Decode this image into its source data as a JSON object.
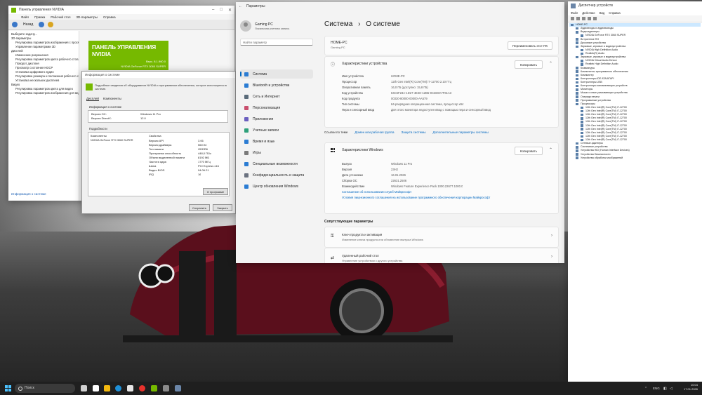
{
  "cp": {
    "title": "Панель управления NVIDIA",
    "menu": [
      "Файл",
      "Правка",
      "Рабочий стол",
      "3D-параметры",
      "Справка"
    ],
    "back": "Назад",
    "tree_header": "Выберите задачу...",
    "tree": [
      {
        "label": "3D-параметры",
        "type": "head"
      },
      {
        "label": "Регулировка параметров изображения с просмотром",
        "type": "link"
      },
      {
        "label": "Управление параметрами 3D",
        "type": "link"
      },
      {
        "label": "Дисплей",
        "type": "head"
      },
      {
        "label": "Изменение разрешения",
        "type": "link"
      },
      {
        "label": "Регулировка параметров цвета рабочего стола",
        "type": "link"
      },
      {
        "label": "Поворот дисплея",
        "type": "link"
      },
      {
        "label": "Просмотр состояния HDCP",
        "type": "link"
      },
      {
        "label": "Установка цифрового аудио",
        "type": "link"
      },
      {
        "label": "Регулировка размера и положения рабочего стола",
        "type": "link"
      },
      {
        "label": "Установка нескольких дисплеев",
        "type": "link"
      },
      {
        "label": "Видео",
        "type": "head"
      },
      {
        "label": "Регулировка параметров цвета для видео",
        "type": "link"
      },
      {
        "label": "Регулировка параметров изображения для видео",
        "type": "link"
      }
    ],
    "banner_title": "ПАНЕЛЬ УПРАВЛЕНИЯ NVIDIA",
    "banner_version": "Верс. 8.1.960.0",
    "banner_gpu": "NVIDIA GeForce RTX 3060 SUPER",
    "info_link": "Информация о системе"
  },
  "si": {
    "title": "Информация о системе",
    "desc": "Подробные сведения об оборудовании NVIDIA и программном обеспечении, которое используется в системе.",
    "tabs": [
      "Дисплей",
      "Компоненты"
    ],
    "sys_section": "Информация о системе",
    "sys_rows": [
      {
        "k": "Версия ОС:",
        "v": "Windows 11 Pro"
      },
      {
        "k": "Версия DirectX:",
        "v": "12.0"
      }
    ],
    "detail_section": "Подробности",
    "col_comp": "Компоненты",
    "col_props": "Свойства",
    "gpu": "NVIDIA GeForce RTX 3060 SUPER",
    "props": [
      {
        "k": "Версия API",
        "v": "3.06"
      },
      {
        "k": "Версия драйвера",
        "v": "560.94"
      },
      {
        "k": "Тип памяти",
        "v": "GDDR6"
      },
      {
        "k": "Пропускная способность",
        "v": "448,0 ГБ/с"
      },
      {
        "k": "Объем выделенной памяти",
        "v": "8192 МБ"
      },
      {
        "k": "Частота ядра",
        "v": "1770 МГц"
      },
      {
        "k": "Шина",
        "v": "PCI Express x16"
      },
      {
        "k": "Видео BIOS",
        "v": "94.06.21"
      },
      {
        "k": "IRQ",
        "v": "16"
      }
    ],
    "about_btn": "О программе",
    "save_btn": "Сохранить",
    "close_btn": "Закрыть"
  },
  "st": {
    "title": "Параметры",
    "user_name": "Gaming PC",
    "user_sub": "Локальная учетная запись",
    "search_placeholder": "Найти параметр",
    "nav": [
      {
        "label": "Система",
        "color": "#2b7cd3",
        "sel": true
      },
      {
        "label": "Bluetooth и устройства",
        "color": "#2b7cd3",
        "sel": false
      },
      {
        "label": "Сеть и Интернет",
        "color": "#5a6b7a",
        "sel": false
      },
      {
        "label": "Персонализация",
        "color": "#c94f6d",
        "sel": false
      },
      {
        "label": "Приложения",
        "color": "#6b5fbf",
        "sel": false
      },
      {
        "label": "Учетные записи",
        "color": "#2ea07a",
        "sel": false
      },
      {
        "label": "Время и язык",
        "color": "#2b7cd3",
        "sel": false
      },
      {
        "label": "Игры",
        "color": "#7a7a7a",
        "sel": false
      },
      {
        "label": "Специальные возможности",
        "color": "#2b7cd3",
        "sel": false
      },
      {
        "label": "Конфиденциальность и защита",
        "color": "#6b7280",
        "sel": false
      },
      {
        "label": "Центр обновления Windows",
        "color": "#2b7cd3",
        "sel": false
      }
    ],
    "crumb_parent": "Система",
    "crumb_sep": "›",
    "crumb_current": "О системе",
    "pc_name": "HOME-PC",
    "pc_model": "Gaming PC",
    "rename_btn": "Переименовать этот ПК",
    "device_title": "Характеристики устройства",
    "copy_btn": "Копировать",
    "device_specs": [
      {
        "k": "Имя устройства",
        "v": "HOME-PC"
      },
      {
        "k": "Процессор",
        "v": "12th Gen Intel(R) Core(TM) i7-12700   2.10 ГГц"
      },
      {
        "k": "Оперативная память",
        "v": "16,0 ГБ (доступно: 15,8 ГБ)"
      },
      {
        "k": "Код устройства",
        "v": "84C6F23A-1D27-4E48-A2B5-9C3D8A7F61A3"
      },
      {
        "k": "Код продукта",
        "v": "00330-80000-00000-AA579"
      },
      {
        "k": "Тип системы",
        "v": "64-разрядная операционная система, процессор x64"
      },
      {
        "k": "Перо и сенсорный ввод",
        "v": "Для этого монитора недоступен ввод с помощью пера и сенсорный ввод"
      }
    ],
    "links": [
      "Ссылки по теме",
      "Домен или рабочая группа",
      "Защита системы",
      "Дополнительные параметры системы"
    ],
    "win_title": "Характеристики Windows",
    "win_specs": [
      {
        "k": "Выпуск",
        "v": "Windows 11 Pro"
      },
      {
        "k": "Версия",
        "v": "23H2"
      },
      {
        "k": "Дата установки",
        "v": "16.01.2026"
      },
      {
        "k": "Сборка ОС",
        "v": "22631.2506"
      },
      {
        "k": "Взаимодействие",
        "v": "Windows Feature Experience Pack 1000.22677.1000.0"
      }
    ],
    "win_link1": "Соглашение об использовании служб Майкрософт",
    "win_link2": "Условия лицензионного соглашения на использование программного обеспечения корпорации Майкрософт",
    "related_section": "Сопутствующие параметры",
    "related": [
      {
        "title": "Ключ продукта и активация",
        "sub": "Изменение ключа продукта или обновление выпуска Windows"
      },
      {
        "title": "Удаленный рабочий стол",
        "sub": "Управление устройством с другого устройства"
      }
    ]
  },
  "dm": {
    "title": "Диспетчер устройств",
    "menu": [
      "Файл",
      "Действие",
      "Вид",
      "Справка"
    ],
    "tree": [
      {
        "label": "HOME-PC",
        "indent": 0,
        "sel": true
      },
      {
        "label": "Аудиовходы и аудиовыходы",
        "indent": 1
      },
      {
        "label": "Видеоадаптеры",
        "indent": 1
      },
      {
        "label": "NVIDIA GeForce RTX 3060 SUPER",
        "indent": 2
      },
      {
        "label": "Встроенное ПО",
        "indent": 1
      },
      {
        "label": "Дисковые устройства",
        "indent": 1
      },
      {
        "label": "Звуковые, игровые и видеоустройства",
        "indent": 1
      },
      {
        "label": "NVIDIA High Definition Audio",
        "indent": 2
      },
      {
        "label": "Realtek(R) Audio",
        "indent": 2
      },
      {
        "label": "Звуковые, игровые и видеоустройства",
        "indent": 1
      },
      {
        "label": "NVIDIA Virtual Audio Device",
        "indent": 2
      },
      {
        "label": "Realtek High Definition Audio",
        "indent": 2
      },
      {
        "label": "Клавиатуры",
        "indent": 1
      },
      {
        "label": "Компоненты программного обеспечения",
        "indent": 1
      },
      {
        "label": "Компьютер",
        "indent": 1
      },
      {
        "label": "Контроллеры IDE ATA/ATAPI",
        "indent": 1
      },
      {
        "label": "Контроллеры USB",
        "indent": 1
      },
      {
        "label": "Контроллеры запоминающих устройств",
        "indent": 1
      },
      {
        "label": "Мониторы",
        "indent": 1
      },
      {
        "label": "Мыши и иные указывающие устройства",
        "indent": 1
      },
      {
        "label": "Очереди печати",
        "indent": 1
      },
      {
        "label": "Программные устройства",
        "indent": 1
      },
      {
        "label": "Процессоры",
        "indent": 1
      },
      {
        "label": "12th Gen Intel(R) Core(TM) i7-12700",
        "indent": 2
      },
      {
        "label": "12th Gen Intel(R) Core(TM) i7-12700",
        "indent": 2
      },
      {
        "label": "12th Gen Intel(R) Core(TM) i7-12700",
        "indent": 2
      },
      {
        "label": "12th Gen Intel(R) Core(TM) i7-12700",
        "indent": 2
      },
      {
        "label": "12th Gen Intel(R) Core(TM) i7-12700",
        "indent": 2
      },
      {
        "label": "12th Gen Intel(R) Core(TM) i7-12700",
        "indent": 2
      },
      {
        "label": "12th Gen Intel(R) Core(TM) i7-12700",
        "indent": 2
      },
      {
        "label": "12th Gen Intel(R) Core(TM) i7-12700",
        "indent": 2
      },
      {
        "label": "12th Gen Intel(R) Core(TM) i7-12700",
        "indent": 2
      },
      {
        "label": "12th Gen Intel(R) Core(TM) i7-12700",
        "indent": 2
      },
      {
        "label": "Сетевые адаптеры",
        "indent": 1
      },
      {
        "label": "Системные устройства",
        "indent": 1
      },
      {
        "label": "Устройства HID (Human Interface Devices)",
        "indent": 1
      },
      {
        "label": "Устройства безопасности",
        "indent": 1
      },
      {
        "label": "Устройства обработки изображений",
        "indent": 1
      }
    ]
  },
  "taskbar": {
    "search": "Поиск",
    "lang": "ENG",
    "time": "10:04",
    "date": "17.01.2026"
  }
}
